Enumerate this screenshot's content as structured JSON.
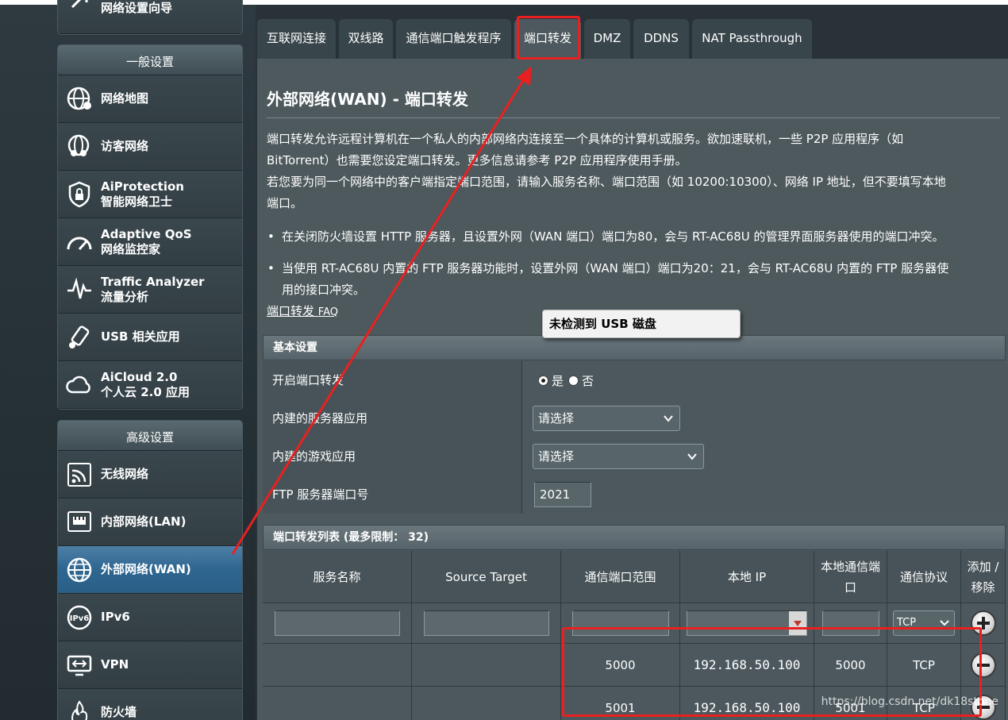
{
  "sidebar": {
    "top_item_partial": "网络设置向导",
    "general_header": "一般设置",
    "general_items": [
      {
        "label": "网络地图",
        "icon": "globe-map-icon"
      },
      {
        "label": "访客网络",
        "icon": "guest-network-icon"
      },
      {
        "label": "AiProtection",
        "label2": "智能网络卫士",
        "icon": "shield-lock-icon"
      },
      {
        "label": "Adaptive QoS",
        "label2": "网络监控家",
        "icon": "speedometer-icon"
      },
      {
        "label": "Traffic Analyzer",
        "label2": "流量分析",
        "icon": "traffic-pulse-icon"
      },
      {
        "label": "USB 相关应用",
        "icon": "usb-icon"
      },
      {
        "label": "AiCloud 2.0",
        "label2": "个人云 2.0 应用",
        "icon": "cloud-icon"
      }
    ],
    "advanced_header": "高级设置",
    "advanced_items": [
      {
        "label": "无线网络",
        "icon": "wifi-icon"
      },
      {
        "label": "内部网络(LAN)",
        "icon": "lan-icon"
      },
      {
        "label": "外部网络(WAN)",
        "icon": "wan-globe-icon",
        "active": true
      },
      {
        "label": "IPv6",
        "icon": "ipv6-icon"
      },
      {
        "label": "VPN",
        "icon": "vpn-icon"
      },
      {
        "label": "防火墙",
        "icon": "firewall-icon"
      }
    ]
  },
  "tabs": [
    {
      "label": "互联网连接"
    },
    {
      "label": "双线路"
    },
    {
      "label": "通信端口触发程序"
    },
    {
      "label": "端口转发",
      "active": true
    },
    {
      "label": "DMZ"
    },
    {
      "label": "DDNS"
    },
    {
      "label": "NAT Passthrough"
    }
  ],
  "page": {
    "title": "外部网络(WAN) - 端口转发",
    "desc1_line1": "端口转发允许远程计算机在一个私人的内部网络内连接至一个具体的计算机或服务。欲加速联机，一些 P2P 应用程序（如",
    "desc1_line2": "BitTorrent）也需要您设定端口转发。更多信息请参考 P2P 应用程序使用手册。",
    "desc2_line1": "若您要为同一个网络中的客户端指定端口范围，请输入服务名称、端口范围（如 10200:10300）、网络 IP 地址，但不要填写本地",
    "desc2_line2": "端口。",
    "bullet1": "在关闭防火墙设置 HTTP 服务器，且设置外网（WAN 端口）端口为80，会与 RT-AC68U 的管理界面服务器使用的端口冲突。",
    "bullet2_line1": "当使用 RT-AC68U 内置的 FTP 服务器功能时，设置外网（WAN 端口）端口为20：21，会与 RT-AC68U 内置的 FTP 服务器使",
    "bullet2_line2": "用的接口冲突。",
    "faq_text": "端口转发 ",
    "faq_suffix": "FAQ",
    "tooltip": "未检测到 USB 磁盘"
  },
  "basic": {
    "header": "基本设置",
    "enable_label": "开启端口转发",
    "yes": "是",
    "no": "否",
    "enabled": true,
    "server_app_label": "内建的服务器应用",
    "server_app_value": "请选择",
    "game_app_label": "内建的游戏应用",
    "game_app_value": "请选择",
    "ftp_port_label": "FTP 服务器端口号",
    "ftp_port_value": "2021"
  },
  "list": {
    "header": "端口转发列表 (最多限制： 32)",
    "columns": [
      "服务名称",
      "Source Target",
      "通信端口范围",
      "本地 IP",
      "本地通信端口",
      "通信协议",
      "添加 / 移除"
    ],
    "new_protocol": "TCP",
    "rows": [
      {
        "service": "",
        "source": "",
        "port_range": "5000",
        "local_ip": "192.168.50.100",
        "local_port": "5000",
        "protocol": "TCP"
      },
      {
        "service": "",
        "source": "",
        "port_range": "5001",
        "local_ip": "192.168.50.100",
        "local_port": "5001",
        "protocol": "TCP"
      }
    ]
  },
  "watermark": "https://blog.csdn.net/dk18stone",
  "colors": {
    "annotation_red": "#ea2020",
    "active_blue": "#2e6690"
  }
}
